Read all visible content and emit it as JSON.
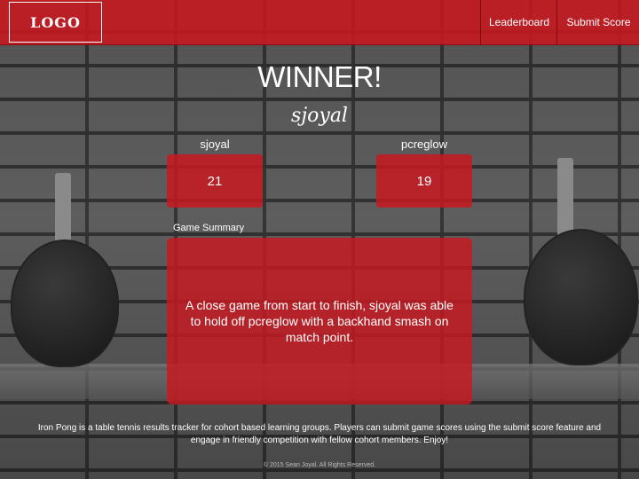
{
  "nav": {
    "logo": "LOGO",
    "leaderboard": "Leaderboard",
    "submit_score": "Submit Score"
  },
  "result": {
    "title": "WINNER!",
    "winner": "sjoyal"
  },
  "players": [
    {
      "name": "sjoyal",
      "score": "21"
    },
    {
      "name": "pcreglow",
      "score": "19"
    }
  ],
  "summary": {
    "label": "Game Summary",
    "text": "A close game from start to finish, sjoyal was able to hold off pcreglow with a backhand smash on match point."
  },
  "footer": {
    "description": "Iron Pong is a table tennis results tracker for cohort based learning groups. Players can submit game scores using the submit score feature and engage in friendly competition with fellow cohort members. Enjoy!",
    "copyright": "© 2015 Sean Joyal. All Rights Reserved."
  },
  "colors": {
    "accent": "#c81820",
    "background": "grayscale brick wall with ping pong paddles"
  }
}
